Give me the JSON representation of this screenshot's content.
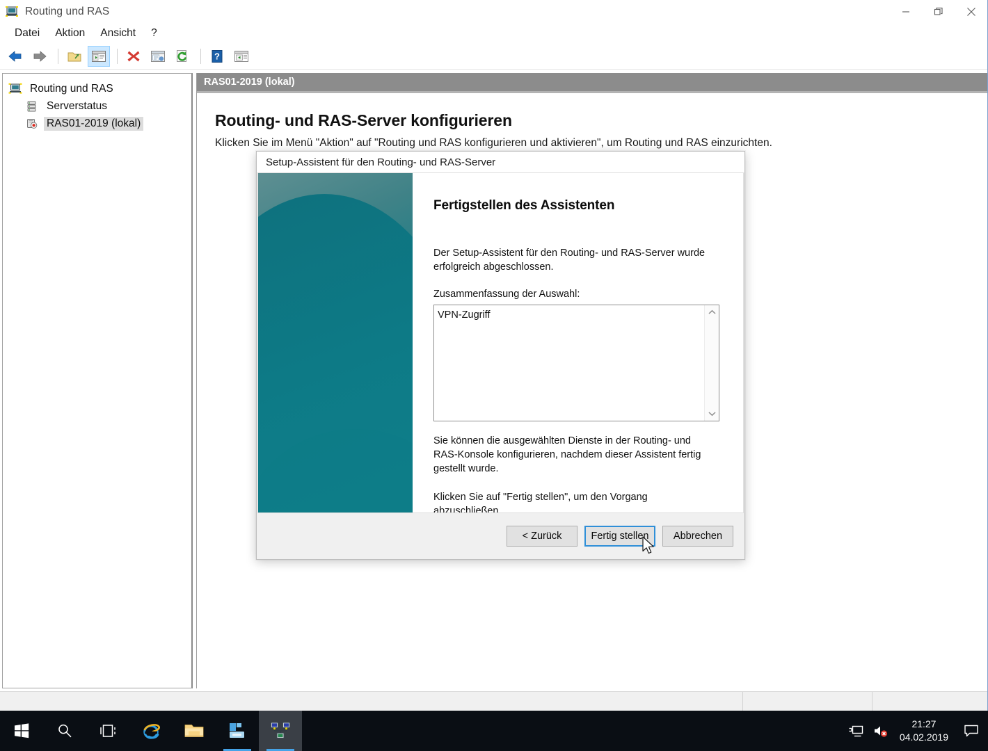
{
  "window": {
    "title": "Routing und RAS",
    "icon": "routing-ras-icon",
    "controls": {
      "minimize": "minimize-icon",
      "restore": "restore-icon",
      "close": "close-icon"
    }
  },
  "menubar": {
    "items": [
      {
        "label": "Datei",
        "name": "menu-datei"
      },
      {
        "label": "Aktion",
        "name": "menu-aktion"
      },
      {
        "label": "Ansicht",
        "name": "menu-ansicht"
      },
      {
        "label": "?",
        "name": "menu-hilfe"
      }
    ]
  },
  "toolbar": {
    "buttons": [
      {
        "name": "back-icon",
        "title": "Zurück"
      },
      {
        "name": "forward-icon",
        "title": "Vorwärts"
      },
      {
        "name": "up-folder-icon",
        "title": "Eine Ebene nach oben"
      },
      {
        "name": "show-hide-tree-icon",
        "title": "Konsolenstruktur ein-/ausblenden",
        "pressed": true
      },
      {
        "name": "delete-icon",
        "title": "Löschen"
      },
      {
        "name": "properties-icon",
        "title": "Eigenschaften"
      },
      {
        "name": "refresh-icon",
        "title": "Aktualisieren"
      },
      {
        "name": "help-icon",
        "title": "Hilfe"
      },
      {
        "name": "export-list-icon",
        "title": "Liste exportieren"
      }
    ]
  },
  "tree": {
    "items": [
      {
        "label": "Routing und RAS",
        "icon": "routing-ras-root-icon",
        "level": 0,
        "selected": false
      },
      {
        "label": "Serverstatus",
        "icon": "server-status-icon",
        "level": 1,
        "selected": false
      },
      {
        "label": "RAS01-2019 (lokal)",
        "icon": "ras-server-icon",
        "level": 1,
        "selected": true
      }
    ]
  },
  "result": {
    "header": "RAS01-2019 (lokal)",
    "title": "Routing- und RAS-Server konfigurieren",
    "subtitle": "Klicken Sie im Menü \"Aktion\" auf \"Routing und RAS konfigurieren und aktivieren\", um Routing und RAS einzurichten."
  },
  "statusbar": {
    "main": "",
    "cell1": "",
    "cell2": ""
  },
  "dialog": {
    "title": "Setup-Assistent für den Routing- und RAS-Server",
    "heading": "Fertigstellen des Assistenten",
    "paragraph1": "Der Setup-Assistent für den Routing- und RAS-Server wurde erfolgreich abgeschlossen.",
    "summary_label": "Zusammenfassung der Auswahl:",
    "summary_items": [
      "VPN-Zugriff"
    ],
    "scroll_up": "scroll-up-icon",
    "scroll_down": "scroll-down-icon",
    "paragraph2": "Sie können die ausgewählten Dienste in der Routing- und RAS-Konsole konfigurieren, nachdem dieser Assistent fertig gestellt wurde.",
    "paragraph3": "Klicken Sie auf \"Fertig stellen\", um den Vorgang abzuschließen.",
    "buttons": {
      "back": "< Zurück",
      "finish": "Fertig stellen",
      "cancel": "Abbrechen"
    }
  },
  "taskbar": {
    "start": "windows-start-icon",
    "items": [
      {
        "name": "search-icon",
        "label": "Suchen",
        "state": "idle"
      },
      {
        "name": "task-view-icon",
        "label": "Taskansicht",
        "state": "idle"
      },
      {
        "name": "internet-explorer-icon",
        "label": "Internet Explorer",
        "state": "idle"
      },
      {
        "name": "file-explorer-icon",
        "label": "Datei-Explorer",
        "state": "idle"
      },
      {
        "name": "server-manager-icon",
        "label": "Server-Manager",
        "state": "running"
      },
      {
        "name": "routing-ras-taskbar-icon",
        "label": "Routing und RAS",
        "state": "active"
      }
    ],
    "tray": {
      "network": "network-icon",
      "volume": "volume-muted-icon",
      "time": "21:27",
      "date": "04.02.2019",
      "action_center": "action-center-icon"
    }
  },
  "colors": {
    "accent": "#2f8fd8",
    "banner_teal": "#0d7b87",
    "header_gray": "#8c8c8c",
    "taskbar": "#0a0e14",
    "selection": "#dcdcdc"
  }
}
